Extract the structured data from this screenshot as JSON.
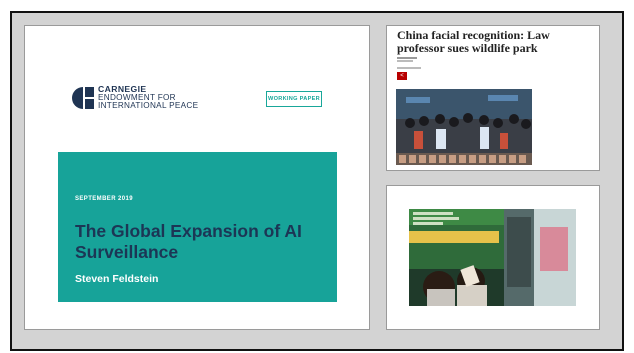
{
  "main_panel": {
    "logo": {
      "line1": "CARNEGIE",
      "line2": "ENDOWMENT FOR",
      "line3": "INTERNATIONAL PEACE",
      "icon": "carnegie-logo-icon"
    },
    "badge": "WORKING PAPER",
    "date": "SEPTEMBER 2019",
    "title": "The Global Expansion of AI Surveillance",
    "author": "Steven Feldstein",
    "colors": {
      "teal": "#17a399",
      "navy": "#1c3655"
    }
  },
  "news_panel": {
    "headline": "China facial recognition: Law professor sues wildlife park",
    "share_icon": "share-icon"
  },
  "photo_panel": {
    "photo_icon": "photo-icon"
  }
}
